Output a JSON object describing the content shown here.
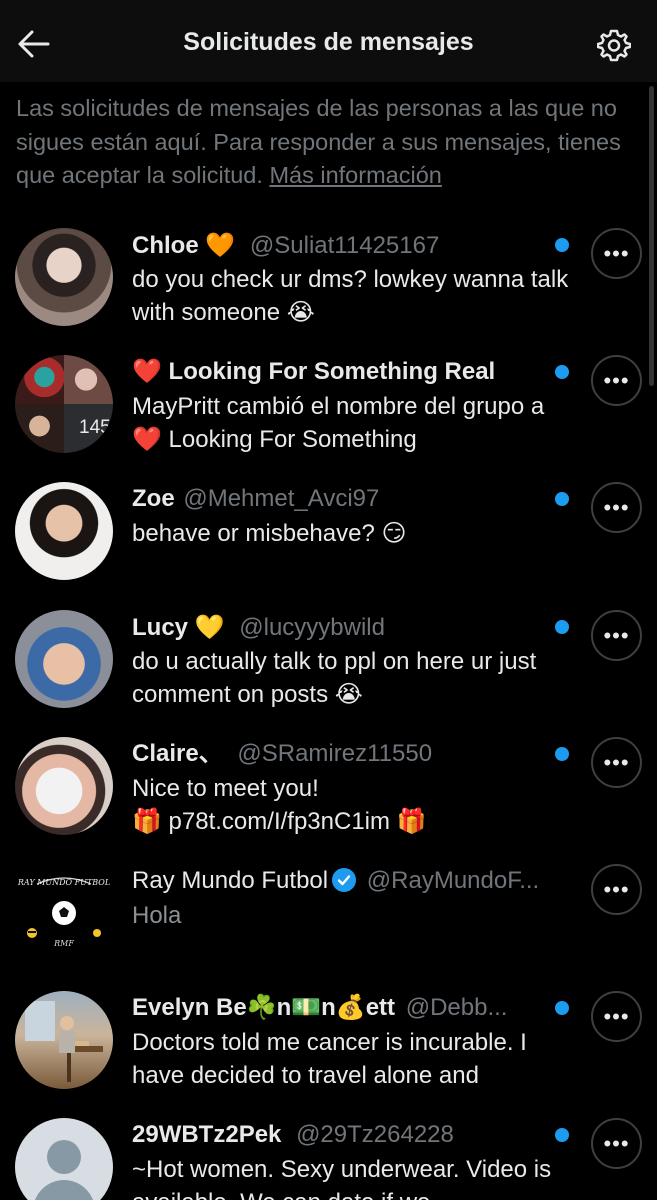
{
  "header": {
    "title": "Solicitudes de mensajes"
  },
  "intro": {
    "text": "Las solicitudes de mensajes de las personas a las que no sigues están aquí. Para responder a sus mensajes, tienes que aceptar la solicitud. ",
    "link": "Más información"
  },
  "requests": [
    {
      "name": "Chloe",
      "emoji": "🧡",
      "handle": "@Suliat11425167",
      "message": "do you check ur dms? lowkey wanna talk with someone 😭",
      "unread": true
    },
    {
      "name": "❤️ Looking For Something Real",
      "group_count": "145",
      "message": "MayPritt cambió el nombre del grupo a ❤️ Looking For Something",
      "unread": true
    },
    {
      "name": "Zoe",
      "handle": "@Mehmet_Avci97",
      "message": "behave or misbehave? 😏",
      "unread": true
    },
    {
      "name": "Lucy",
      "emoji": "💛",
      "handle": "@lucyyybwild",
      "message": "do u actually talk to ppl on here ur just comment on posts 😭",
      "unread": true
    },
    {
      "name": "Claire、",
      "handle": "@SRamirez11550",
      "message_line1": "Nice to meet you!",
      "message_line2": "🎁 p78t.com/I/fp3nC1im 🎁",
      "unread": true
    },
    {
      "name": "Ray Mundo Futbol",
      "verified": true,
      "handle": "@RayMundoF...",
      "message": "Hola",
      "unread": false
    },
    {
      "name": "Evelyn Be☘️n💵n💰ett",
      "handle": "@Debb...",
      "message": "Doctors told me cancer is incurable. I have decided to travel alone and",
      "unread": true
    },
    {
      "name": "29WBTz2Pek",
      "handle": "@29Tz264228",
      "message": "~Hot women. Sexy underwear. Video is available. We can date if we",
      "unread": true
    }
  ],
  "more_glyph": "•••",
  "colors": {
    "accent": "#1d9bf0",
    "muted": "#71767b",
    "background": "#000000"
  }
}
